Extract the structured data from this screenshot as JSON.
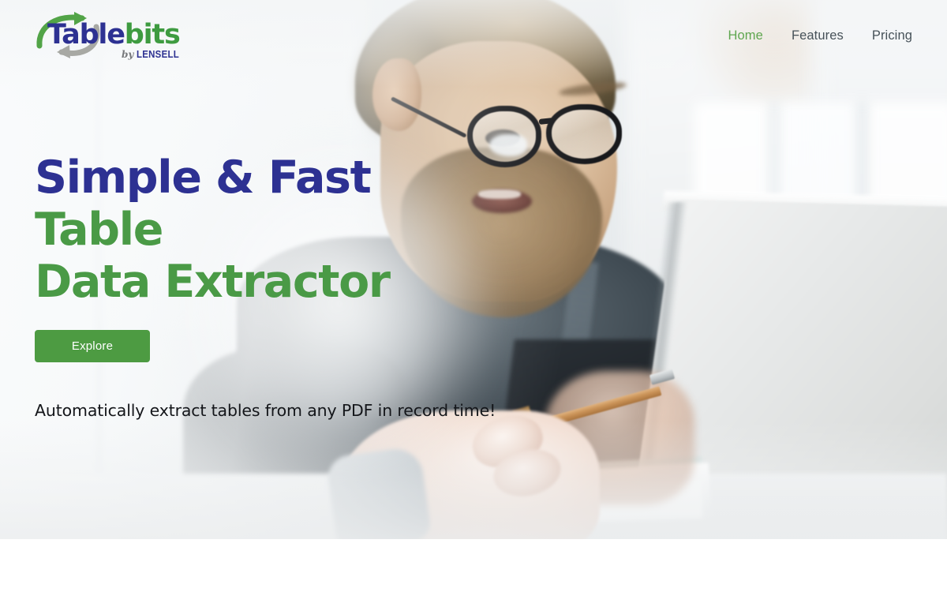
{
  "site": {
    "brand_name_part1": "Table",
    "brand_name_part2": "bits",
    "brand_byline_prefix": "by",
    "brand_byline_company": "LENSELL",
    "logo_icon_top": "curved-arrow-up-right-icon",
    "logo_icon_bottom": "curved-arrow-down-left-icon"
  },
  "nav": {
    "items": [
      {
        "label": "Home",
        "active": true
      },
      {
        "label": "Features",
        "active": false
      },
      {
        "label": "Pricing",
        "active": false
      }
    ]
  },
  "hero": {
    "headline_line1": "Simple & Fast",
    "headline_line2": "Table",
    "headline_line3": "Data Extractor",
    "cta_label": "Explore",
    "tagline": "Automatically extract tables from any PDF in record time!",
    "background_description": "Bearded man with glasses working at a laptop holding a pencil in a bright office"
  },
  "colors": {
    "brand_blue": "#2d3192",
    "brand_green": "#3e9b40",
    "heading_green": "#4a9a46",
    "cta_green": "#4d9b42",
    "nav_active_green": "#5fa64f",
    "nav_text": "#475259",
    "tagline_text": "#14161a",
    "page_background": "#ffffff"
  }
}
